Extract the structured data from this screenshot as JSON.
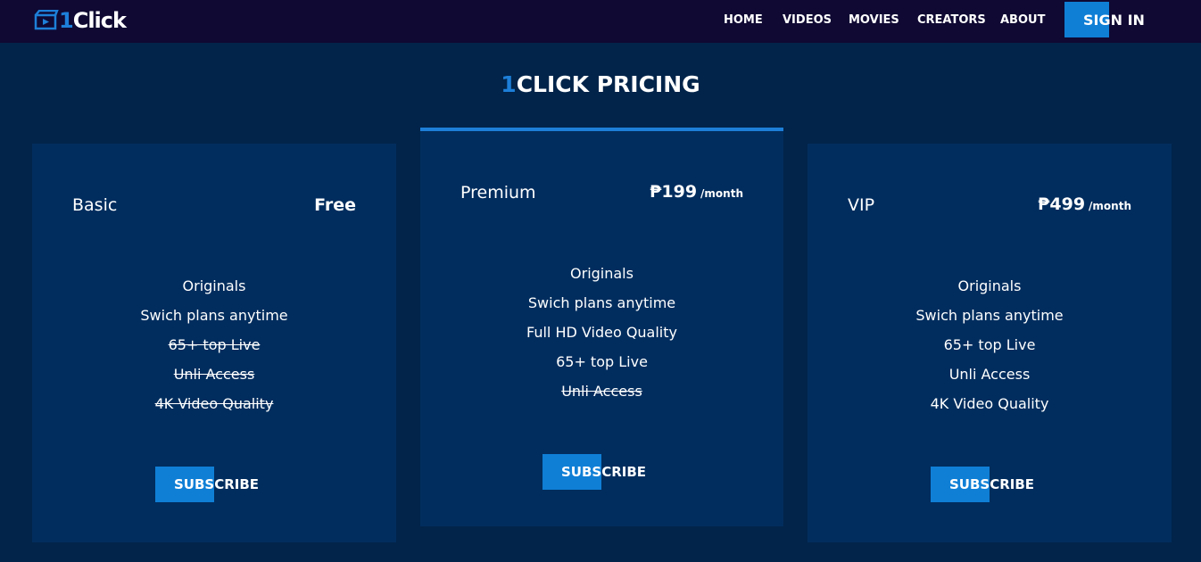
{
  "brand": {
    "logo_prefix": "1",
    "logo_rest": "Click"
  },
  "nav": {
    "home": "HOME",
    "videos": "VIDEOS",
    "movies": "MOVIES",
    "creators": "CREATORS",
    "about": "ABOUT",
    "sign_in": "SIGN IN"
  },
  "page": {
    "title_accent": "1",
    "title_rest": "CLICK PRICING"
  },
  "plans": [
    {
      "name": "Basic",
      "price": "Free",
      "period": "",
      "features": [
        "Originals",
        "Swich plans anytime",
        "65+ top Live",
        "Unli Access",
        "4K Video Quality"
      ],
      "included": [
        true,
        true,
        false,
        false,
        false
      ],
      "button": "SUBSCRIBE"
    },
    {
      "name": "Premium",
      "price": "₱199",
      "period": "/month",
      "features": [
        "Originals",
        "Swich plans anytime",
        "Full HD Video Quality",
        "65+ top Live",
        "Unli Access"
      ],
      "included": [
        true,
        true,
        true,
        true,
        false
      ],
      "button": "SUBSCRIBE"
    },
    {
      "name": "VIP",
      "price": "₱499",
      "period": "/month",
      "features": [
        "Originals",
        "Swich plans anytime",
        "65+ top Live",
        "Unli Access",
        "4K Video Quality"
      ],
      "included": [
        true,
        true,
        true,
        true,
        true
      ],
      "button": "SUBSCRIBE"
    }
  ],
  "colors": {
    "background": "#02244a",
    "topbar": "#0f0933",
    "card": "#012d5e",
    "accent": "#1d7fd8",
    "button": "#0f7fd6"
  },
  "icons": {
    "logo": "film-clapper-icon"
  }
}
